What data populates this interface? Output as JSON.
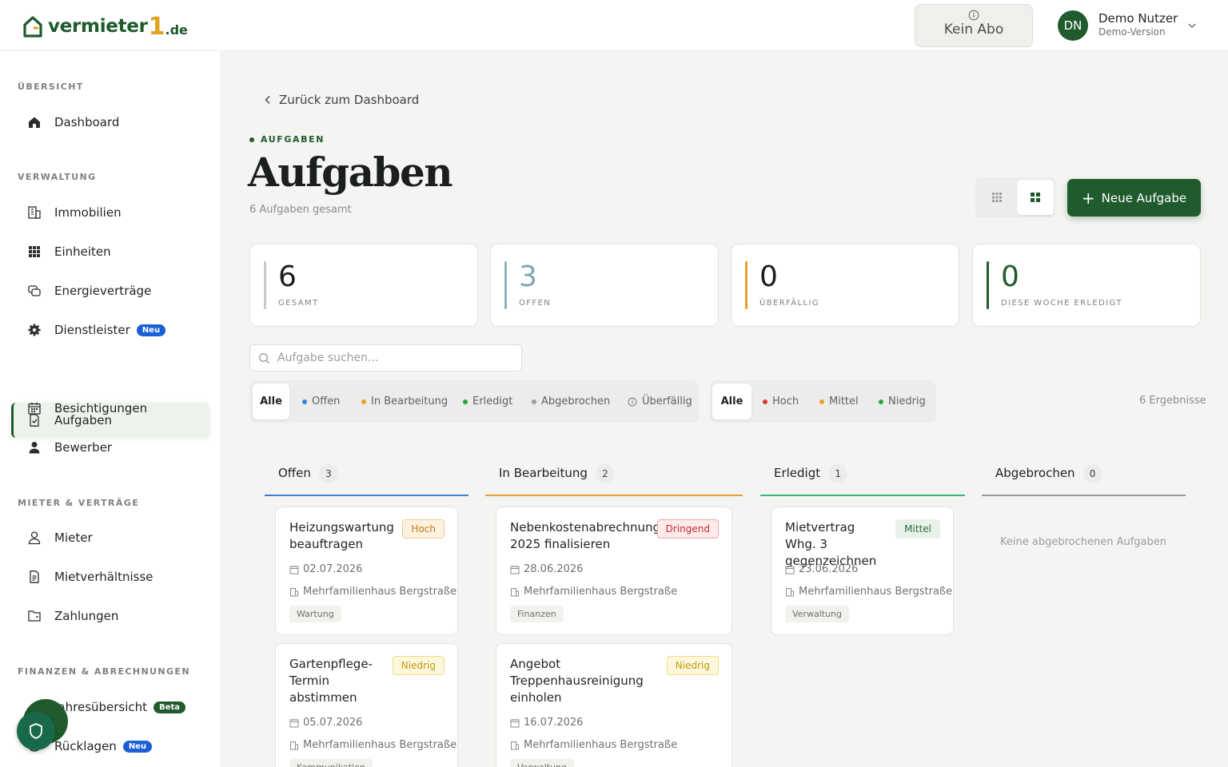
{
  "brand": {
    "name": "vermieter",
    "number": "1",
    "tld": ".de"
  },
  "header": {
    "subscription_label": "Kein Abo",
    "user": {
      "initials": "DN",
      "name": "Demo Nutzer",
      "subtitle": "Demo-Version"
    }
  },
  "sidebar": {
    "sections": [
      {
        "title": "ÜBERSICHT",
        "items": [
          {
            "label": "Dashboard",
            "icon": "home-icon"
          }
        ]
      },
      {
        "title": "VERWALTUNG",
        "items": [
          {
            "label": "Immobilien",
            "icon": "building-icon"
          },
          {
            "label": "Einheiten",
            "icon": "grid-icon"
          },
          {
            "label": "Energieverträge",
            "icon": "contracts-icon"
          },
          {
            "label": "Dienstleister",
            "icon": "gear-icon",
            "badge": "Neu"
          },
          {
            "label": "Aufgaben",
            "icon": "task-icon",
            "active": true
          },
          {
            "label": "Besichtigungen",
            "icon": "calendar-icon"
          },
          {
            "label": "Bewerber",
            "icon": "user-icon"
          }
        ]
      },
      {
        "title": "MIETER & VERTRÄGE",
        "items": [
          {
            "label": "Mieter",
            "icon": "user-outline-icon"
          },
          {
            "label": "Mietverhältnisse",
            "icon": "document-icon"
          },
          {
            "label": "Zahlungen",
            "icon": "folder-icon"
          }
        ]
      },
      {
        "title": "FINANZEN & ABRECHNUNGEN",
        "items": [
          {
            "label": "Jahresübersicht",
            "icon": "chart-icon",
            "badge": "Beta"
          },
          {
            "label": "Rücklagen",
            "icon": "piggy-icon",
            "badge": "Neu"
          }
        ]
      }
    ]
  },
  "main": {
    "back_link": "Zurück zum Dashboard",
    "eyebrow": "AUFGABEN",
    "title": "Aufgaben",
    "subtitle": "6 Aufgaben gesamt",
    "new_button": "Neue Aufgabe",
    "stats": [
      {
        "value": "6",
        "label": "GESAMT",
        "color": "#c9c9c5"
      },
      {
        "value": "3",
        "label": "OFFEN",
        "color": "#8fb0c0"
      },
      {
        "value": "0",
        "label": "ÜBERFÄLLIG",
        "color": "#e7a021"
      },
      {
        "value": "0",
        "label": "DIESE WOCHE ERLEDIGT",
        "color": "#1f5b2c"
      }
    ],
    "search_placeholder": "Aufgabe suchen...",
    "status_filters": [
      {
        "label": "Alle",
        "active": true
      },
      {
        "label": "Offen",
        "dot": "#2a87d8"
      },
      {
        "label": "In Bearbeitung",
        "dot": "#f0a020"
      },
      {
        "label": "Erledigt",
        "dot": "#2da04a"
      },
      {
        "label": "Abgebrochen",
        "dot": "#9a9e9b"
      },
      {
        "label": "Überfällig",
        "icon": "info-icon"
      }
    ],
    "priority_filters": [
      {
        "label": "Alle",
        "active": true
      },
      {
        "label": "Hoch",
        "dot": "#e0352b"
      },
      {
        "label": "Mittel",
        "dot": "#f0a020"
      },
      {
        "label": "Niedrig",
        "dot": "#2da04a"
      }
    ],
    "results": "6 Ergebnisse",
    "columns": [
      {
        "title": "Offen",
        "count": "3",
        "color": "#3b82d6"
      },
      {
        "title": "In Bearbeitung",
        "count": "2",
        "color": "#e9a23b"
      },
      {
        "title": "Erledigt",
        "count": "1",
        "color": "#3fb37f"
      },
      {
        "title": "Abgebrochen",
        "count": "0",
        "color": "#9a9e9b",
        "empty": "Keine abgebrochenen Aufgaben"
      }
    ],
    "cards": [
      {
        "title": "Heizungswartung beauftragen",
        "priority": "Hoch",
        "kind": "hoch",
        "date": "02.07.2026",
        "property": "Mehrfamilienhaus Bergstraße",
        "tag": "Wartung"
      },
      {
        "title": "Gartenpflege-Termin abstimmen",
        "priority": "Niedrig",
        "kind": "niedrig",
        "date": "05.07.2026",
        "property": "Mehrfamilienhaus Bergstraße",
        "tag": "Kommunikation"
      },
      {
        "title": "Nebenkostenabrechnung 2025 finalisieren",
        "priority": "Dringend",
        "kind": "dringend",
        "date": "28.06.2026",
        "property": "Mehrfamilienhaus Bergstraße",
        "tag": "Finanzen"
      },
      {
        "title": "Angebot Treppenhausreinigung einholen",
        "priority": "Niedrig",
        "kind": "niedrig",
        "date": "16.07.2026",
        "property": "Mehrfamilienhaus Bergstraße",
        "tag": "Verwaltung"
      },
      {
        "title": "Mietvertrag Whg. 3 gegenzeichnen",
        "priority": "Mittel",
        "kind": "mittel",
        "date": "23.06.2026",
        "property": "Mehrfamilienhaus Bergstraße",
        "tag": "Verwaltung"
      }
    ]
  }
}
